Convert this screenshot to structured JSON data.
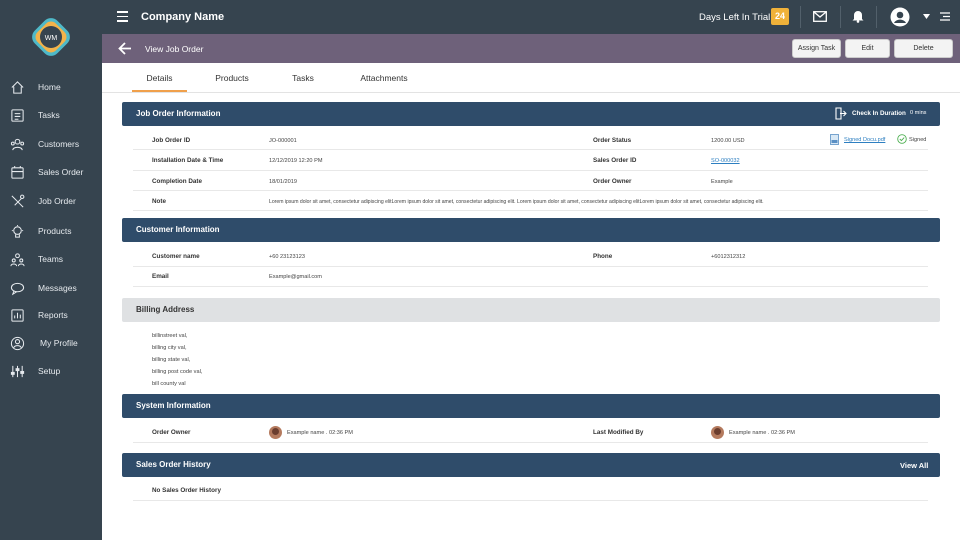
{
  "colors": {
    "sidebar": "#36444f",
    "subbar": "#6e617a",
    "section_header": "#2f4c6a",
    "accent": "#f0a04b",
    "trial_badge": "#f0b23a"
  },
  "sidebar": {
    "items": [
      {
        "label": "Home",
        "icon": "home-icon"
      },
      {
        "label": "Tasks",
        "icon": "tasks-icon"
      },
      {
        "label": "Customers",
        "icon": "customers-icon"
      },
      {
        "label": "Sales Order",
        "icon": "sales-order-icon"
      },
      {
        "label": "Job Order",
        "icon": "job-order-icon"
      },
      {
        "label": "Products",
        "icon": "products-icon"
      },
      {
        "label": "Teams",
        "icon": "teams-icon"
      },
      {
        "label": "Messages",
        "icon": "messages-icon"
      },
      {
        "label": "Reports",
        "icon": "reports-icon"
      },
      {
        "label": "My Profile",
        "icon": "profile-icon"
      },
      {
        "label": "Setup",
        "icon": "setup-icon"
      }
    ]
  },
  "topbar": {
    "company": "Company Name",
    "trial_label": "Days Left In Trial",
    "trial_days": "24"
  },
  "subbar": {
    "title": "View Job Order",
    "assign_task": "Assign Task",
    "edit": "Edit",
    "delete": "Delete"
  },
  "tabs": [
    "Details",
    "Products",
    "Tasks",
    "Attachments"
  ],
  "job_order": {
    "title": "Job Order Information",
    "check_in_label": "Check In Duration",
    "check_in_value": "0 mins",
    "job_order_id_label": "Job Order ID",
    "job_order_id": "JO-000001",
    "install_label": "Installation Date & Time",
    "install": "12/12/2019 12:20 PM",
    "completion_label": "Completion Date",
    "completion": "18/01/2019",
    "note_label": "Note",
    "note": "Lorem ipsum dolor sit amet, consectetur adipiscing elitLorem ipsum dolor sit amet, consectetur adipiscing elit. Lorem ipsum dolor sit amet, consectetur adipiscing elitLorem ipsum dolor sit amet, consectetur adipiscing elit.",
    "status_label": "Order Status",
    "status": "1200.00 USD",
    "signed_doc": "Signed Docu.pdf",
    "signed": "Signed",
    "so_label": "Sales Order ID",
    "so": "SO-000032",
    "owner_label": "Order Owner",
    "owner": "Example"
  },
  "customer": {
    "title": "Customer Information",
    "name_label": "Customer name",
    "name": "+60 23123123",
    "email_label": "Email",
    "email": "Example@gmail.com",
    "phone_label": "Phone",
    "phone": "+6012312312"
  },
  "billing": {
    "title": "Billing Address",
    "lines": [
      "billinstreet val,",
      "billing city val,",
      "billing state val,",
      "billing post code val,",
      "bill county val"
    ]
  },
  "system": {
    "title": "System Information",
    "owner_label": "Order Owner",
    "owner": "Example name . 02:36 PM",
    "modified_label": "Last Modified By",
    "modified": "Example name . 02:36 PM"
  },
  "history": {
    "title": "Sales Order History",
    "view_all": "View All",
    "empty": "No Sales Order History"
  }
}
